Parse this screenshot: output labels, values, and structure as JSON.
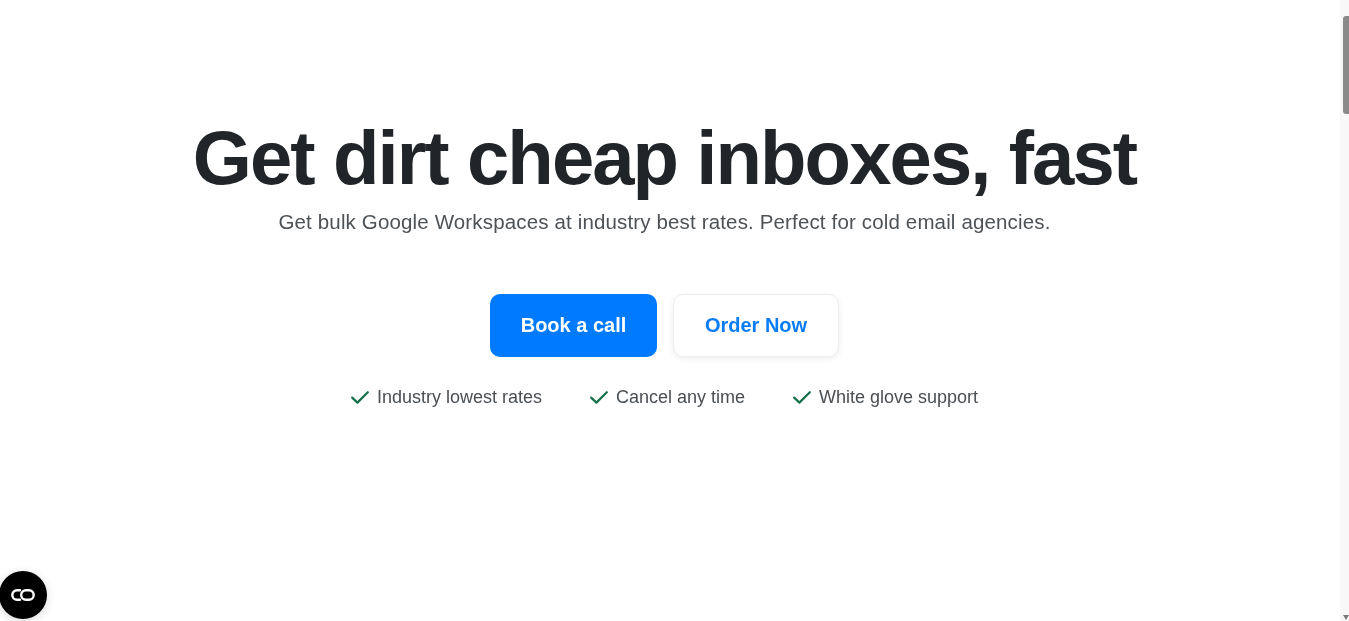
{
  "hero": {
    "title": "Get dirt cheap inboxes, fast",
    "subtitle": "Get bulk Google Workspaces at industry best rates. Perfect for cold email agencies."
  },
  "actions": [
    {
      "label": "Book a call",
      "kind": "primary"
    },
    {
      "label": "Order Now",
      "kind": "secondary"
    }
  ],
  "features": [
    {
      "label": "Industry lowest rates"
    },
    {
      "label": "Cancel any time"
    },
    {
      "label": "White glove support"
    }
  ]
}
